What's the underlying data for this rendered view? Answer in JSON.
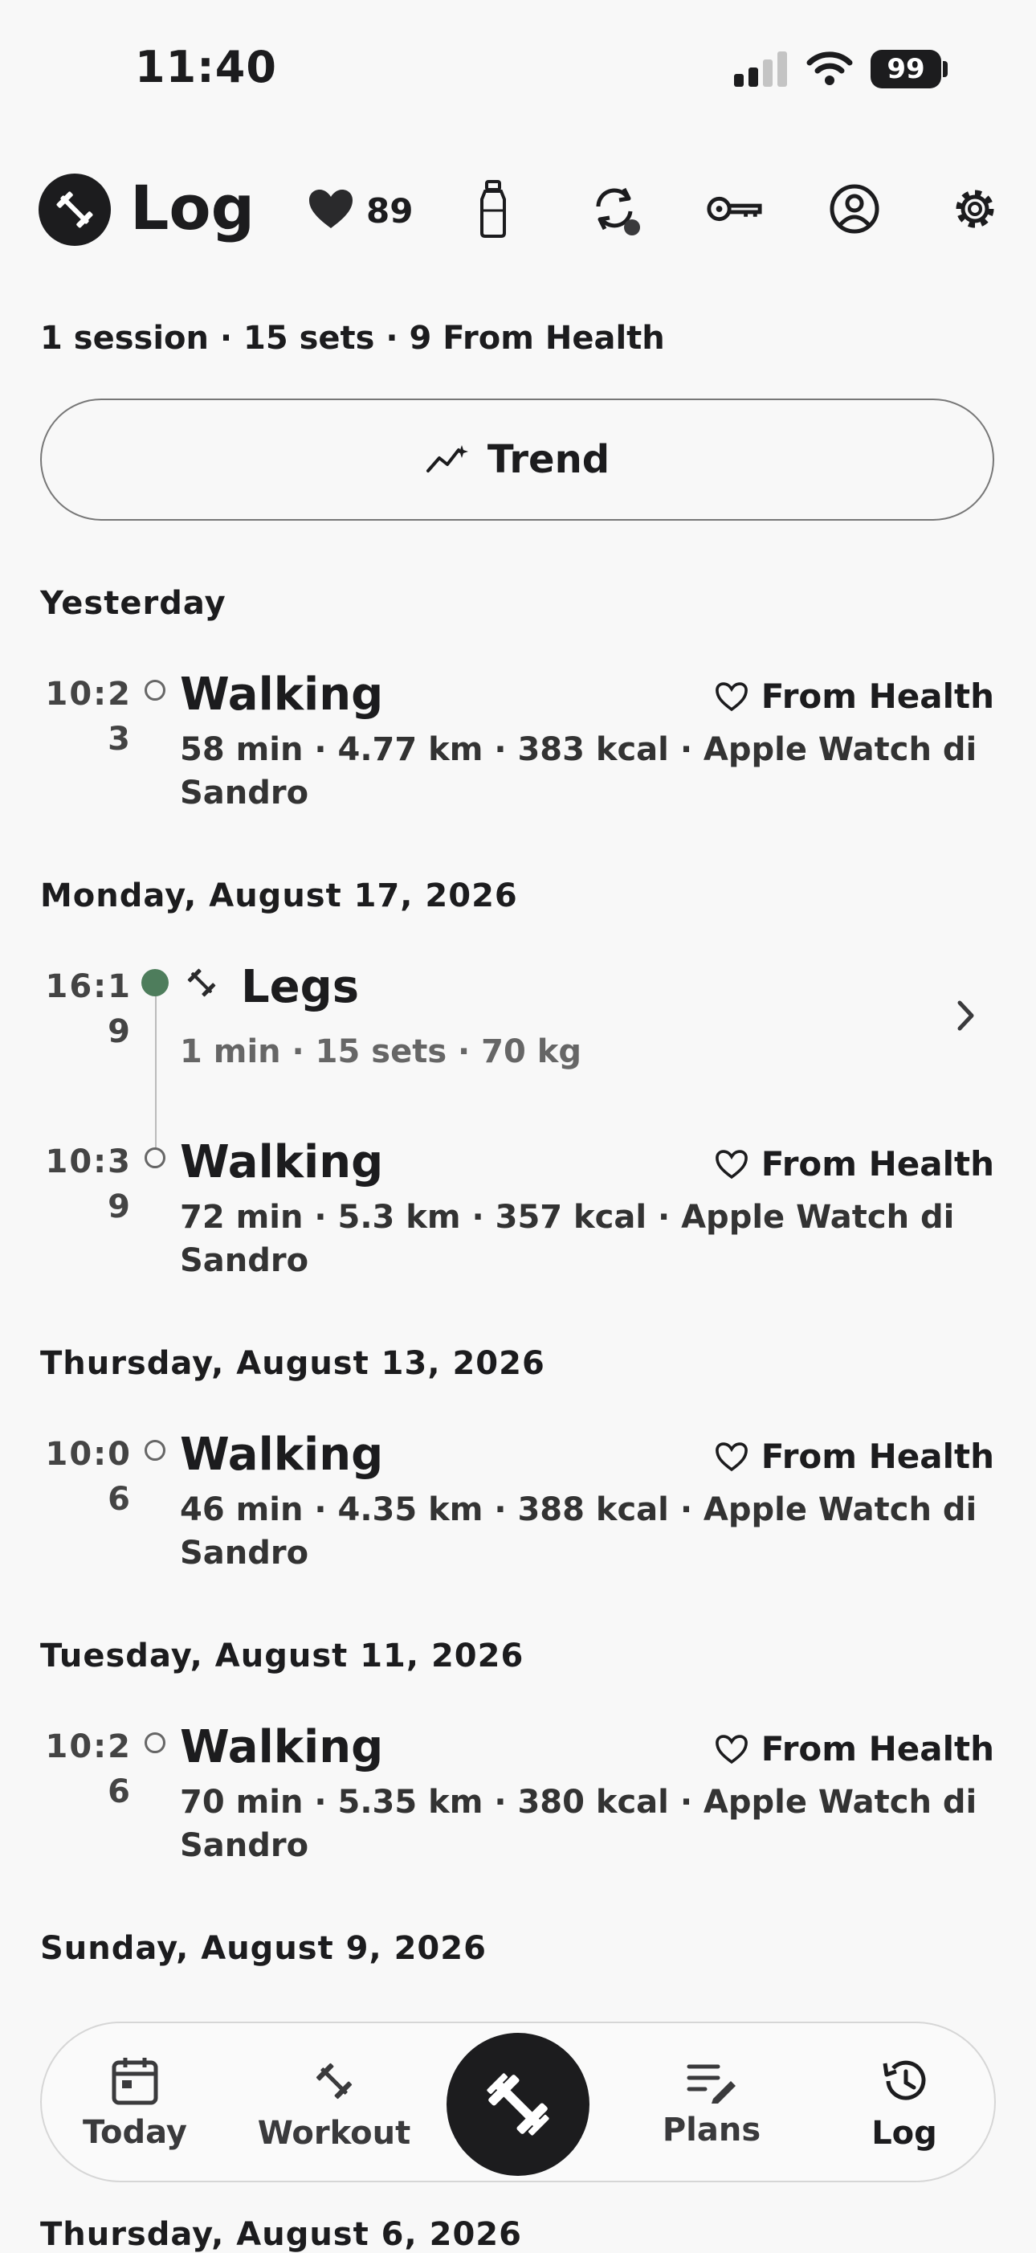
{
  "status_bar": {
    "time": "11:40",
    "battery": "99"
  },
  "header": {
    "title": "Log",
    "heart_rate": "89"
  },
  "summary": "1 session · 15 sets · 9 From Health",
  "trend_button": "Trend",
  "days": [
    {
      "date": "Yesterday",
      "entries": [
        {
          "time": "10:23",
          "title": "Walking",
          "source": "From Health",
          "detail": "58 min · 4.77 km · 383 kcal · Apple Watch di Sandro"
        }
      ]
    },
    {
      "date": "Monday, August 17, 2026",
      "entries": [
        {
          "time": "16:19",
          "title": "Legs",
          "detail": "1 min · 15 sets · 70 kg"
        },
        {
          "time": "10:39",
          "title": "Walking",
          "source": "From Health",
          "detail": "72 min · 5.3 km · 357 kcal · Apple Watch di Sandro"
        }
      ]
    },
    {
      "date": "Thursday, August 13, 2026",
      "entries": [
        {
          "time": "10:06",
          "title": "Walking",
          "source": "From Health",
          "detail": "46 min · 4.35 km · 388 kcal · Apple Watch di Sandro"
        }
      ]
    },
    {
      "date": "Tuesday, August 11, 2026",
      "entries": [
        {
          "time": "10:26",
          "title": "Walking",
          "source": "From Health",
          "detail": "70 min · 5.35 km · 380 kcal · Apple Watch di Sandro"
        }
      ]
    },
    {
      "date": "Sunday, August 9, 2026"
    },
    {
      "date": "Thursday, August 6, 2026"
    }
  ],
  "tabs": {
    "today": "Today",
    "workout": "Workout",
    "plans": "Plans",
    "log": "Log"
  },
  "colors": {
    "accent": "#4e7d5c",
    "dark": "#1c1c1e"
  }
}
